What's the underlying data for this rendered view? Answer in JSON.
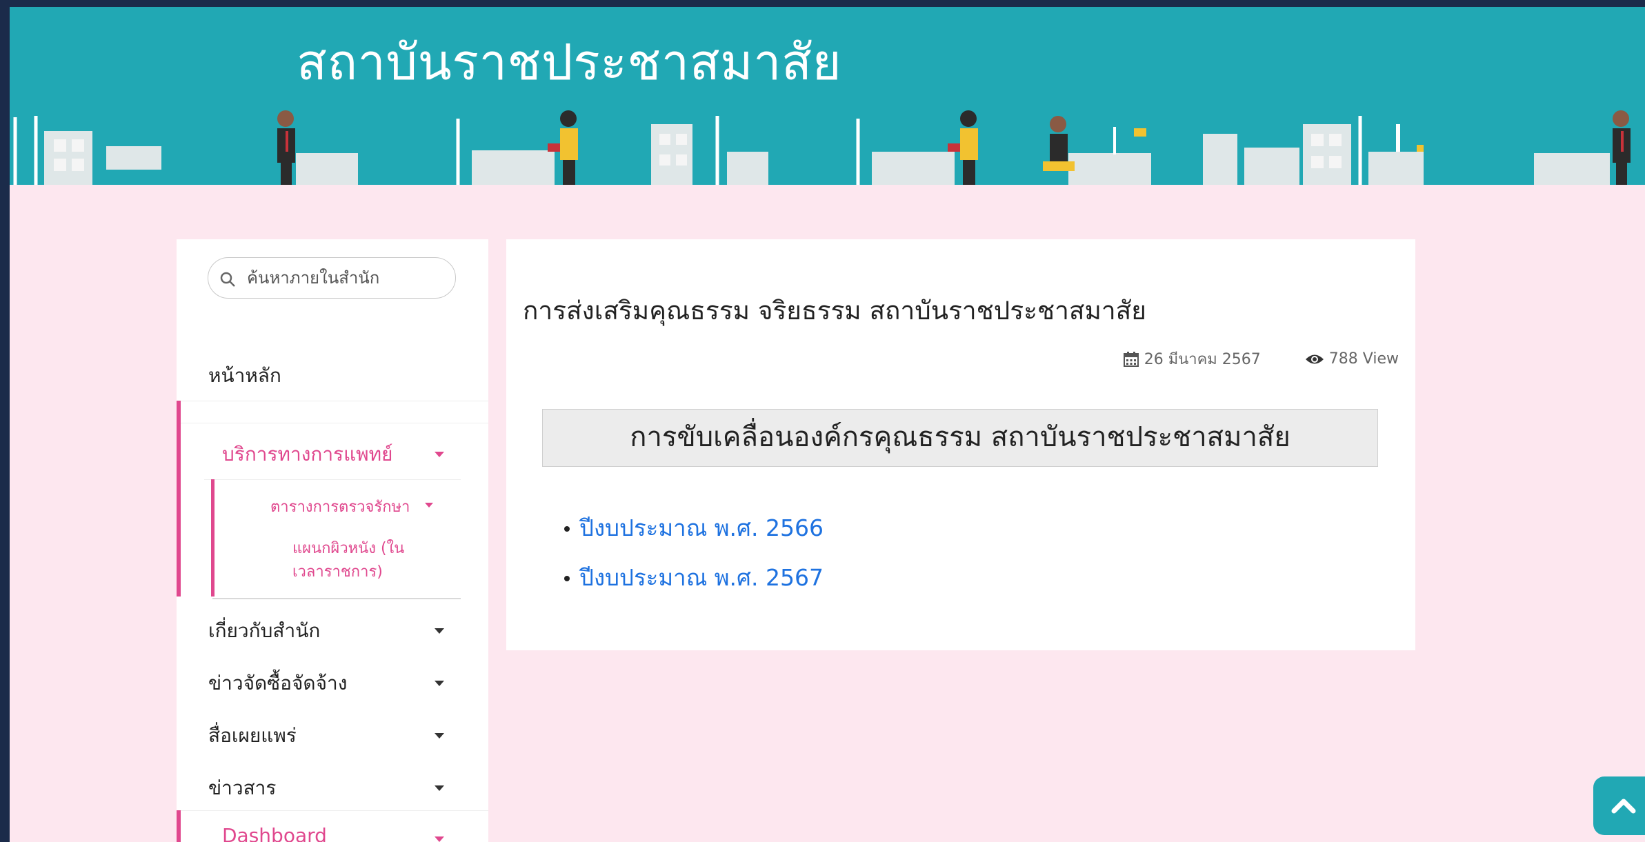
{
  "header": {
    "site_title": "สถาบันราชประชาสมาสัย"
  },
  "sidebar": {
    "search_placeholder": "ค้นหาภายในสำนัก",
    "home": "หน้าหลัก",
    "medical": "บริการทางการแพทย์",
    "schedule": "ตารางการตรวจรักษา",
    "skin_line1": "แผนกผิวหนัง (ใน",
    "skin_line2": "เวลาราชการ)",
    "about": "เกี่ยวกับสำนัก",
    "procurement": "ข่าวจัดซื้อจัดจ้าง",
    "media": "สื่อเผยแพร่",
    "news": "ข่าวสาร",
    "dashboard": "Dashboard"
  },
  "article": {
    "title": "การส่งเสริมคุณธรรม จริยธรรม สถาบันราชประชาสมาสัย",
    "date": "26 มีนาคม 2567",
    "views": "788 View",
    "banner": "การขับเคลื่อนองค์กรคุณธรรม สถาบันราชประชาสมาสัย",
    "links": [
      "ปีงบประมาณ พ.ศ. 2566",
      "ปีงบประมาณ พ.ศ. 2567"
    ]
  },
  "colors": {
    "header": "#21a8b4",
    "page_bg": "#fde7ef",
    "accent_pink": "#e0488e",
    "link": "#1e72e0"
  },
  "icons": [
    "search-icon",
    "calendar-icon",
    "eye-icon",
    "chevron-up-icon"
  ]
}
